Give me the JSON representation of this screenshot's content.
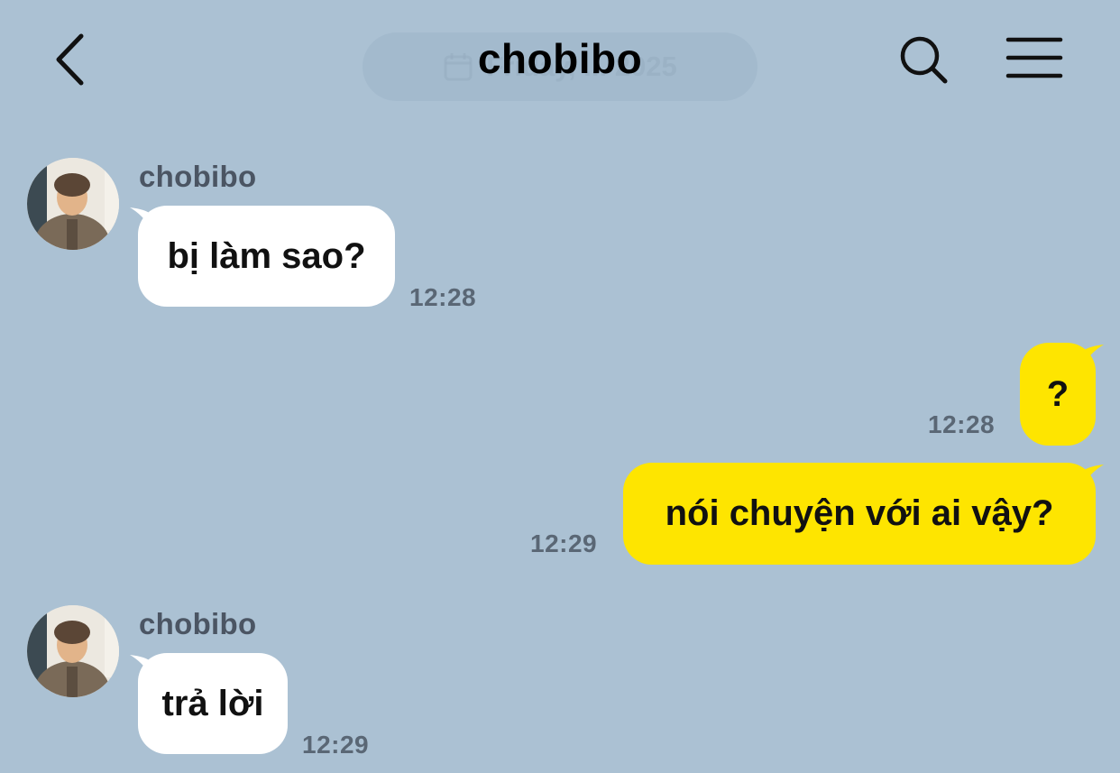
{
  "header": {
    "title": "chobibo",
    "date_label": "Friday, ... 2025",
    "back_icon": "chevron-left-icon",
    "search_icon": "search-icon",
    "menu_icon": "hamburger-menu-icon"
  },
  "colors": {
    "background": "#abc1d3",
    "incoming_bubble": "#ffffff",
    "outgoing_bubble": "#fee500"
  },
  "messages": [
    {
      "direction": "incoming",
      "sender": "chobibo",
      "text": "bị làm sao?",
      "time": "12:28"
    },
    {
      "direction": "outgoing",
      "text": "?",
      "time": "12:28"
    },
    {
      "direction": "outgoing",
      "text": "nói chuyện với ai vậy?",
      "time": "12:29"
    },
    {
      "direction": "incoming",
      "sender": "chobibo",
      "text": "trả lời",
      "time": "12:29"
    }
  ]
}
